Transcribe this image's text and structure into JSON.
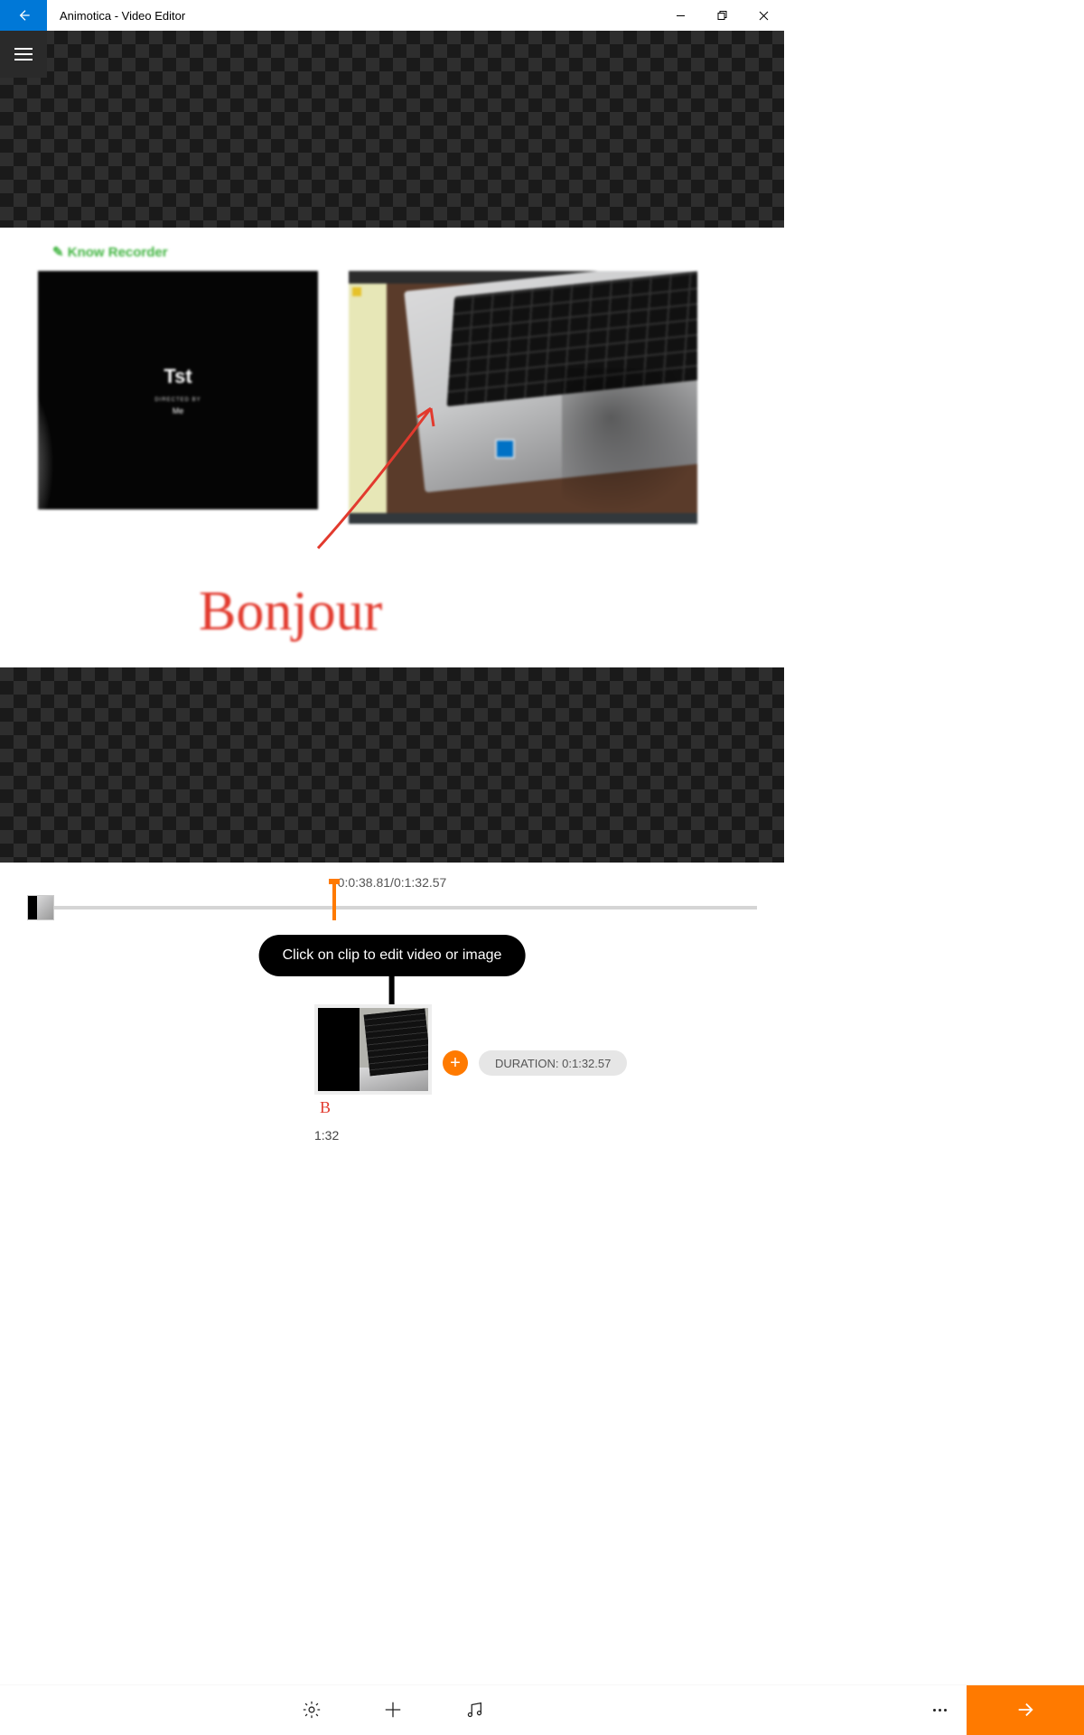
{
  "window": {
    "title": "Animotica - Video Editor"
  },
  "preview": {
    "logo_text": "Know Recorder",
    "title_text": "Tst",
    "subtitle_text": "DIRECTED BY",
    "author_text": "Me",
    "handwriting": "Bonjour",
    "current_time": "0:0:38.81",
    "total_time": "0:1:32.57",
    "separator": " / "
  },
  "tooltip": {
    "text": "Click on clip to edit video or image"
  },
  "clip": {
    "duration_short": "1:32",
    "scribble": "B"
  },
  "duration_pill": {
    "label": "DURATION: 0:1:32.57"
  },
  "colors": {
    "accent": "#ff7a00",
    "win_accent": "#0078d7",
    "ink": "#e23a2e"
  }
}
